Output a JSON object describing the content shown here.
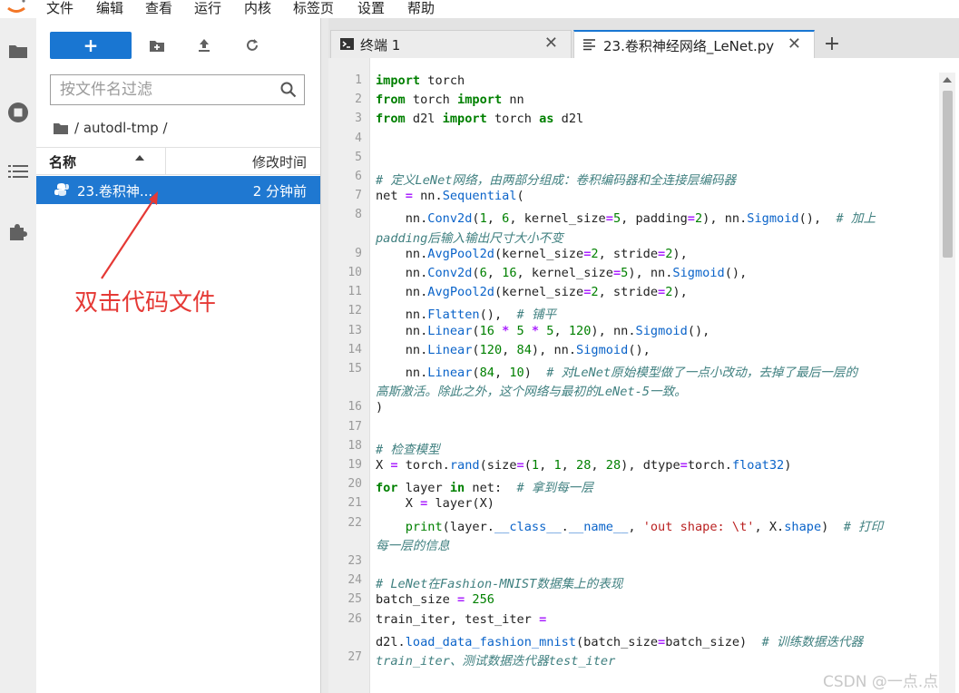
{
  "menu": [
    "文件",
    "编辑",
    "查看",
    "运行",
    "内核",
    "标签页",
    "设置",
    "帮助"
  ],
  "activity_icons": [
    "folder-icon",
    "running-stop-icon",
    "toc-icon",
    "extension-puzzle-icon"
  ],
  "file_browser": {
    "new_label": "+",
    "filter_placeholder": "按文件名过滤",
    "breadcrumb": "/ autodl-tmp /",
    "col_name": "名称",
    "col_modified": "修改时间",
    "files": [
      {
        "name": "23.卷积神...",
        "modified": "2 分钟前"
      }
    ]
  },
  "annotation": "双击代码文件",
  "tabs": [
    {
      "label": "终端 1",
      "icon": "terminal-icon",
      "close": "✕"
    },
    {
      "label": "23.卷积神经网络_LeNet.py",
      "icon": "text-file-icon",
      "close": "✕"
    }
  ],
  "add_tab": "+",
  "code": {
    "line_numbers": [
      "1",
      "2",
      "3",
      "4",
      "5",
      "6",
      "7",
      "8",
      "",
      "9",
      "10",
      "11",
      "12",
      "13",
      "14",
      "15",
      "",
      "16",
      "17",
      "18",
      "19",
      "20",
      "21",
      "22",
      "",
      "23",
      "24",
      "25",
      "26",
      "",
      "27"
    ],
    "lines": [
      [
        {
          "t": "import",
          "c": "kw"
        },
        {
          "t": " torch"
        }
      ],
      [
        {
          "t": "from",
          "c": "kw"
        },
        {
          "t": " torch "
        },
        {
          "t": "import",
          "c": "kw"
        },
        {
          "t": " nn"
        }
      ],
      [
        {
          "t": "from",
          "c": "kw"
        },
        {
          "t": " d2l "
        },
        {
          "t": "import",
          "c": "kw"
        },
        {
          "t": " torch "
        },
        {
          "t": "as",
          "c": "kw"
        },
        {
          "t": " d2l"
        }
      ],
      [],
      [],
      [
        {
          "t": "# 定义LeNet网络，由两部分组成：卷积编码器和全连接层编码器",
          "c": "cm"
        }
      ],
      [
        {
          "t": "net "
        },
        {
          "t": "=",
          "c": "op"
        },
        {
          "t": " nn."
        },
        {
          "t": "Sequential",
          "c": "fn"
        },
        {
          "t": "("
        }
      ],
      [
        {
          "t": "    nn."
        },
        {
          "t": "Conv2d",
          "c": "fn"
        },
        {
          "t": "("
        },
        {
          "t": "1",
          "c": "num"
        },
        {
          "t": ", "
        },
        {
          "t": "6",
          "c": "num"
        },
        {
          "t": ", kernel_size"
        },
        {
          "t": "=",
          "c": "op"
        },
        {
          "t": "5",
          "c": "num"
        },
        {
          "t": ", padding"
        },
        {
          "t": "=",
          "c": "op"
        },
        {
          "t": "2",
          "c": "num"
        },
        {
          "t": "), nn."
        },
        {
          "t": "Sigmoid",
          "c": "fn"
        },
        {
          "t": "(),  "
        },
        {
          "t": "# 加上",
          "c": "cm"
        }
      ],
      [
        {
          "t": "padding后输入输出尺寸大小不变",
          "c": "cm"
        }
      ],
      [
        {
          "t": "    nn."
        },
        {
          "t": "AvgPool2d",
          "c": "fn"
        },
        {
          "t": "(kernel_size"
        },
        {
          "t": "=",
          "c": "op"
        },
        {
          "t": "2",
          "c": "num"
        },
        {
          "t": ", stride"
        },
        {
          "t": "=",
          "c": "op"
        },
        {
          "t": "2",
          "c": "num"
        },
        {
          "t": "),"
        }
      ],
      [
        {
          "t": "    nn."
        },
        {
          "t": "Conv2d",
          "c": "fn"
        },
        {
          "t": "("
        },
        {
          "t": "6",
          "c": "num"
        },
        {
          "t": ", "
        },
        {
          "t": "16",
          "c": "num"
        },
        {
          "t": ", kernel_size"
        },
        {
          "t": "=",
          "c": "op"
        },
        {
          "t": "5",
          "c": "num"
        },
        {
          "t": "), nn."
        },
        {
          "t": "Sigmoid",
          "c": "fn"
        },
        {
          "t": "(),"
        }
      ],
      [
        {
          "t": "    nn."
        },
        {
          "t": "AvgPool2d",
          "c": "fn"
        },
        {
          "t": "(kernel_size"
        },
        {
          "t": "=",
          "c": "op"
        },
        {
          "t": "2",
          "c": "num"
        },
        {
          "t": ", stride"
        },
        {
          "t": "=",
          "c": "op"
        },
        {
          "t": "2",
          "c": "num"
        },
        {
          "t": "),"
        }
      ],
      [
        {
          "t": "    nn."
        },
        {
          "t": "Flatten",
          "c": "fn"
        },
        {
          "t": "(),  "
        },
        {
          "t": "# 铺平",
          "c": "cm"
        }
      ],
      [
        {
          "t": "    nn."
        },
        {
          "t": "Linear",
          "c": "fn"
        },
        {
          "t": "("
        },
        {
          "t": "16",
          "c": "num"
        },
        {
          "t": " "
        },
        {
          "t": "*",
          "c": "op"
        },
        {
          "t": " "
        },
        {
          "t": "5",
          "c": "num"
        },
        {
          "t": " "
        },
        {
          "t": "*",
          "c": "op"
        },
        {
          "t": " "
        },
        {
          "t": "5",
          "c": "num"
        },
        {
          "t": ", "
        },
        {
          "t": "120",
          "c": "num"
        },
        {
          "t": "), nn."
        },
        {
          "t": "Sigmoid",
          "c": "fn"
        },
        {
          "t": "(),"
        }
      ],
      [
        {
          "t": "    nn."
        },
        {
          "t": "Linear",
          "c": "fn"
        },
        {
          "t": "("
        },
        {
          "t": "120",
          "c": "num"
        },
        {
          "t": ", "
        },
        {
          "t": "84",
          "c": "num"
        },
        {
          "t": "), nn."
        },
        {
          "t": "Sigmoid",
          "c": "fn"
        },
        {
          "t": "(),"
        }
      ],
      [
        {
          "t": "    nn."
        },
        {
          "t": "Linear",
          "c": "fn"
        },
        {
          "t": "("
        },
        {
          "t": "84",
          "c": "num"
        },
        {
          "t": ", "
        },
        {
          "t": "10",
          "c": "num"
        },
        {
          "t": ")  "
        },
        {
          "t": "# 对LeNet原始模型做了一点小改动，去掉了最后一层的",
          "c": "cm"
        }
      ],
      [
        {
          "t": "高斯激活。除此之外，这个网络与最初的LeNet-5一致。",
          "c": "cm"
        }
      ],
      [
        {
          "t": ")"
        }
      ],
      [],
      [
        {
          "t": "# 检查模型",
          "c": "cm"
        }
      ],
      [
        {
          "t": "X "
        },
        {
          "t": "=",
          "c": "op"
        },
        {
          "t": " torch."
        },
        {
          "t": "rand",
          "c": "fn"
        },
        {
          "t": "(size"
        },
        {
          "t": "=",
          "c": "op"
        },
        {
          "t": "("
        },
        {
          "t": "1",
          "c": "num"
        },
        {
          "t": ", "
        },
        {
          "t": "1",
          "c": "num"
        },
        {
          "t": ", "
        },
        {
          "t": "28",
          "c": "num"
        },
        {
          "t": ", "
        },
        {
          "t": "28",
          "c": "num"
        },
        {
          "t": "), dtype"
        },
        {
          "t": "=",
          "c": "op"
        },
        {
          "t": "torch."
        },
        {
          "t": "float32",
          "c": "fn"
        },
        {
          "t": ")"
        }
      ],
      [
        {
          "t": "for",
          "c": "kw"
        },
        {
          "t": " layer "
        },
        {
          "t": "in",
          "c": "kw"
        },
        {
          "t": " net:  "
        },
        {
          "t": "# 拿到每一层",
          "c": "cm"
        }
      ],
      [
        {
          "t": "    X "
        },
        {
          "t": "=",
          "c": "op"
        },
        {
          "t": " layer(X)"
        }
      ],
      [
        {
          "t": "    "
        },
        {
          "t": "print",
          "c": "num"
        },
        {
          "t": "(layer."
        },
        {
          "t": "__class__",
          "c": "fn"
        },
        {
          "t": "."
        },
        {
          "t": "__name__",
          "c": "fn"
        },
        {
          "t": ", "
        },
        {
          "t": "'out shape: \\t'",
          "c": "str"
        },
        {
          "t": ", X."
        },
        {
          "t": "shape",
          "c": "fn"
        },
        {
          "t": ")  "
        },
        {
          "t": "# 打印",
          "c": "cm"
        }
      ],
      [
        {
          "t": "每一层的信息",
          "c": "cm"
        }
      ],
      [],
      [
        {
          "t": "# LeNet在Fashion-MNIST数据集上的表现",
          "c": "cm"
        }
      ],
      [
        {
          "t": "batch_size "
        },
        {
          "t": "=",
          "c": "op"
        },
        {
          "t": " "
        },
        {
          "t": "256",
          "c": "num"
        }
      ],
      [
        {
          "t": "train_iter, test_iter "
        },
        {
          "t": "=",
          "c": "op"
        }
      ],
      [
        {
          "t": "d2l."
        },
        {
          "t": "load_data_fashion_mnist",
          "c": "fn"
        },
        {
          "t": "(batch_size"
        },
        {
          "t": "=",
          "c": "op"
        },
        {
          "t": "batch_size)  "
        },
        {
          "t": "# 训练数据迭代器",
          "c": "cm"
        }
      ],
      [
        {
          "t": "train_iter、测试数据迭代器test_iter",
          "c": "cm"
        }
      ],
      []
    ]
  },
  "watermark": "CSDN @一点.点"
}
